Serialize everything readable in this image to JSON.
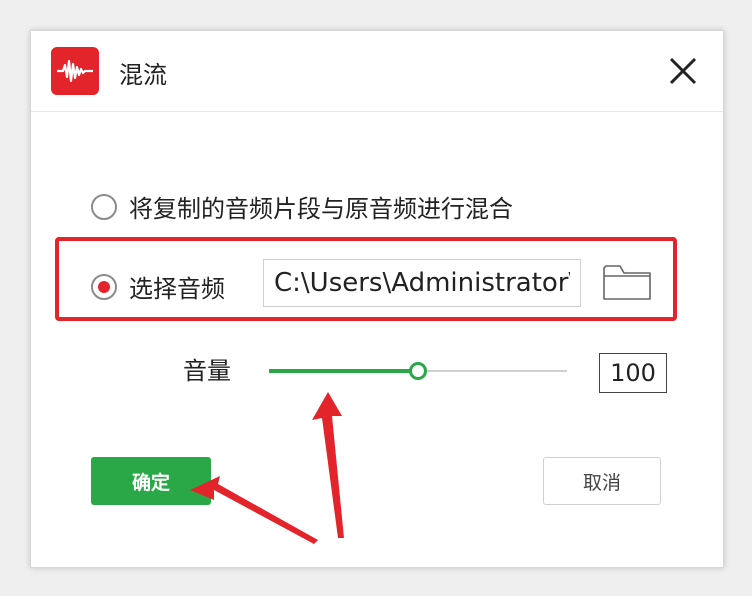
{
  "window": {
    "title": "混流",
    "app_icon": "waveform-icon",
    "close_icon": "close-icon"
  },
  "options": {
    "mix_original": {
      "label": "将复制的音频片段与原音频进行混合",
      "selected": false
    },
    "select_audio": {
      "label": "选择音频",
      "selected": true,
      "path_value": "C:\\Users\\Administrator\\",
      "folder_icon": "folder-icon"
    }
  },
  "volume": {
    "label": "音量",
    "slider_fraction": 0.5,
    "value": "100"
  },
  "buttons": {
    "ok_label": "确定",
    "cancel_label": "取消"
  },
  "colors": {
    "accent_green": "#2aa848",
    "annotation_red": "#e3242b",
    "app_icon_red": "#e3242b"
  }
}
